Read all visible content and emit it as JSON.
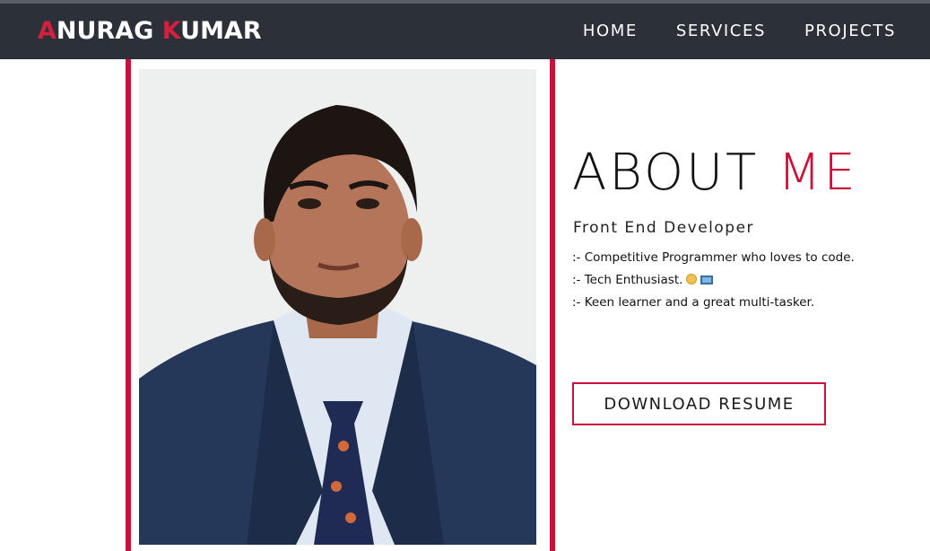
{
  "brand": {
    "initial_1": "A",
    "rest_1": "NURAG ",
    "initial_2": "K",
    "rest_2": "UMAR"
  },
  "nav": {
    "items": [
      {
        "label": "HOME"
      },
      {
        "label": "SERVICES"
      },
      {
        "label": "PROJECTS"
      }
    ]
  },
  "about": {
    "title_main": "ABOUT ",
    "title_accent": "ME",
    "role": "Front End Developer",
    "bullets": [
      {
        "text": ":- Competitive Programmer who loves to code."
      },
      {
        "text": ":- Tech Enthusiast."
      },
      {
        "text": ":- Keen learner and a great multi-tasker."
      }
    ],
    "resume_button": "DOWNLOAD RESUME"
  },
  "colors": {
    "accent": "#c8123a",
    "navbar": "#2b3039"
  }
}
